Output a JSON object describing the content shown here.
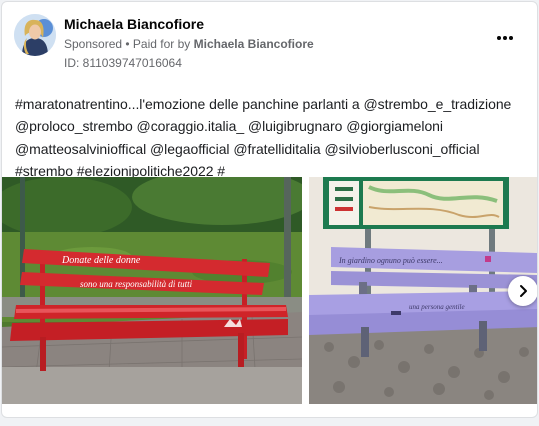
{
  "post": {
    "author": "Michaela Biancofiore",
    "sponsored": "Sponsored",
    "separator": " • ",
    "paid_for_prefix": "Paid for by ",
    "paid_for_name": "Michaela Biancofiore",
    "library_id": "ID: 811039747016064",
    "text": "#maratonatrentino...l'emozione delle panchine parlanti a @strembo_e_tradizione @proloco_strembo @coraggio.italia_ @luigibrugnaro @giorgiameloni @matteosalvinioffical @legaofficial @fratelliditalia @silvioberlusconi_official #strembo #elezionipolitiche2022 #"
  },
  "icons": {
    "more": "more-horizontal-icon",
    "next": "chevron-right-icon"
  },
  "colors": {
    "bench_red": "#d42a2f",
    "bench_lavender": "#a79ee0",
    "map_board_green": "#1d7a4f",
    "meta_grey": "#65676b"
  }
}
